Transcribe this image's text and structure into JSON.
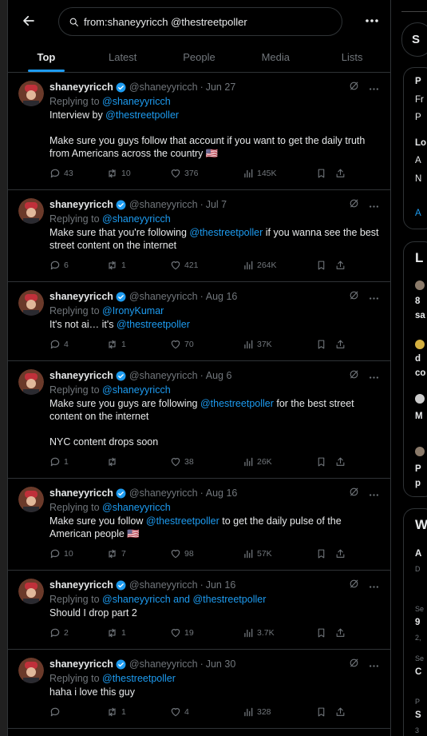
{
  "search": {
    "query": "from:shaneyyricch @thestreetpoller"
  },
  "tabs": [
    {
      "label": "Top",
      "active": true
    },
    {
      "label": "Latest"
    },
    {
      "label": "People"
    },
    {
      "label": "Media"
    },
    {
      "label": "Lists"
    }
  ],
  "tweets": [
    {
      "name": "shaneyyricch",
      "handle": "@shaneyyricch",
      "date": "Jun 27",
      "reply_prefix": "Replying to ",
      "reply_to": "@shaneyyricch",
      "line1_pre": "Interview by ",
      "line1_link": "@thestreetpoller",
      "line2": "Make sure you guys follow that account if you want to get the daily truth from Americans across the country 🇺🇸",
      "replies": "43",
      "retweets": "10",
      "likes": "376",
      "views": "145K"
    },
    {
      "name": "shaneyyricch",
      "handle": "@shaneyyricch",
      "date": "Jul 7",
      "reply_prefix": "Replying to ",
      "reply_to": "@shaneyyricch",
      "text_pre": "Make sure that you're following ",
      "text_link": "@thestreetpoller",
      "text_post": " if you wanna see the best street content on the internet",
      "replies": "6",
      "retweets": "1",
      "likes": "421",
      "views": "264K"
    },
    {
      "name": "shaneyyricch",
      "handle": "@shaneyyricch",
      "date": "Aug 16",
      "reply_prefix": "Replying to ",
      "reply_to": "@IronyKumar",
      "text_pre": "It's not ai… it's ",
      "text_link": "@thestreetpoller",
      "replies": "4",
      "retweets": "1",
      "likes": "70",
      "views": "37K"
    },
    {
      "name": "shaneyyricch",
      "handle": "@shaneyyricch",
      "date": "Aug 6",
      "reply_prefix": "Replying to ",
      "reply_to": "@shaneyyricch",
      "text_pre": "Make sure you guys are following ",
      "text_link": "@thestreetpoller",
      "text_post": " for the best street content on the internet",
      "line2": "NYC content drops soon",
      "replies": "1",
      "retweets": "",
      "likes": "38",
      "views": "26K"
    },
    {
      "name": "shaneyyricch",
      "handle": "@shaneyyricch",
      "date": "Aug 16",
      "reply_prefix": "Replying to ",
      "reply_to": "@shaneyyricch",
      "text_pre": "Make sure you follow ",
      "text_link": "@thestreetpoller",
      "text_post": " to get the daily pulse of the American people 🇺🇸",
      "replies": "10",
      "retweets": "7",
      "likes": "98",
      "views": "57K"
    },
    {
      "name": "shaneyyricch",
      "handle": "@shaneyyricch",
      "date": "Jun 16",
      "reply_prefix": "Replying to ",
      "reply_to": "@shaneyyricch and @thestreetpoller",
      "text_pre": "Should I drop part 2",
      "replies": "2",
      "retweets": "1",
      "likes": "19",
      "views": "3.7K"
    },
    {
      "name": "shaneyyricch",
      "handle": "@shaneyyricch",
      "date": "Jun 30",
      "reply_prefix": "Replying to ",
      "reply_to": "@thestreetpoller",
      "text_pre": "haha i love this guy",
      "replies": "",
      "retweets": "1",
      "likes": "4",
      "views": "328"
    }
  ],
  "right_panel": {
    "search_letter": "S",
    "p1": [
      "P",
      "Fr",
      "P",
      "Lo",
      "A",
      "N",
      "A"
    ],
    "p2": [
      "L",
      "8",
      "sa",
      "d",
      "co",
      "M",
      "P",
      "p"
    ],
    "p3": [
      "W",
      "A",
      "D",
      "Se",
      "9",
      "2,",
      "Se",
      "C",
      "P",
      "S",
      "3"
    ]
  },
  "colors": {
    "accent": "#1d9bf0",
    "border": "#2f3336",
    "muted": "#71767b",
    "text": "#e7e9ea"
  }
}
